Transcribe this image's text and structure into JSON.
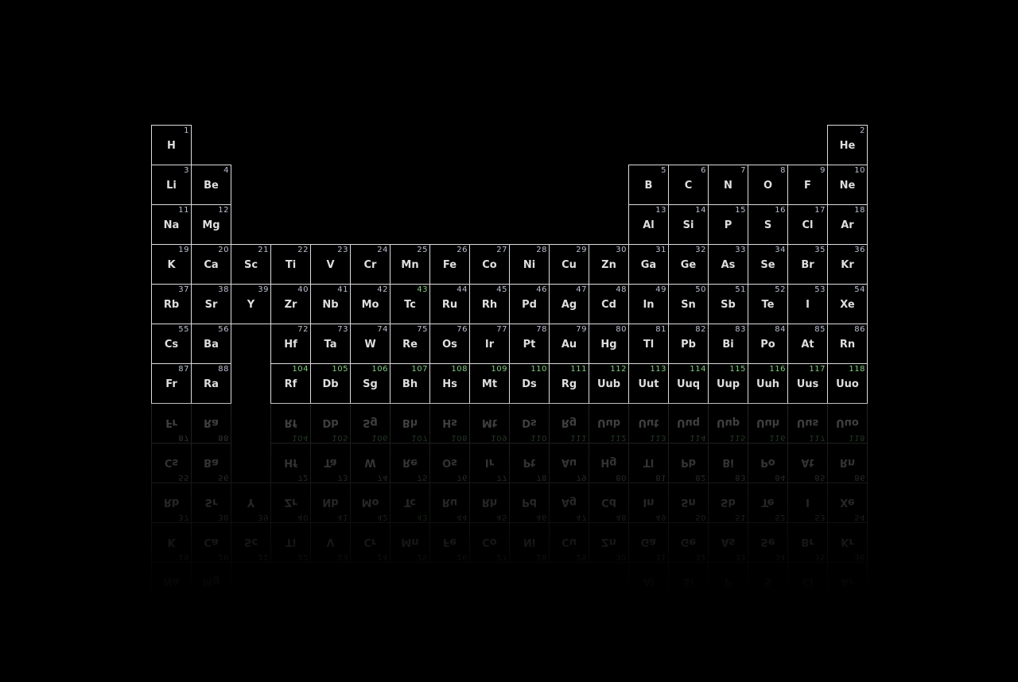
{
  "colors": {
    "background": "#000000",
    "border": "#dcdcdc",
    "symbol": "#dedede",
    "number": "#b8c0d0",
    "synthetic_number": "#7fcf7f"
  },
  "elements": [
    {
      "n": 1,
      "s": "H",
      "p": 1,
      "g": 1
    },
    {
      "n": 2,
      "s": "He",
      "p": 1,
      "g": 18
    },
    {
      "n": 3,
      "s": "Li",
      "p": 2,
      "g": 1
    },
    {
      "n": 4,
      "s": "Be",
      "p": 2,
      "g": 2
    },
    {
      "n": 5,
      "s": "B",
      "p": 2,
      "g": 13
    },
    {
      "n": 6,
      "s": "C",
      "p": 2,
      "g": 14
    },
    {
      "n": 7,
      "s": "N",
      "p": 2,
      "g": 15
    },
    {
      "n": 8,
      "s": "O",
      "p": 2,
      "g": 16
    },
    {
      "n": 9,
      "s": "F",
      "p": 2,
      "g": 17
    },
    {
      "n": 10,
      "s": "Ne",
      "p": 2,
      "g": 18
    },
    {
      "n": 11,
      "s": "Na",
      "p": 3,
      "g": 1
    },
    {
      "n": 12,
      "s": "Mg",
      "p": 3,
      "g": 2
    },
    {
      "n": 13,
      "s": "Al",
      "p": 3,
      "g": 13
    },
    {
      "n": 14,
      "s": "Si",
      "p": 3,
      "g": 14
    },
    {
      "n": 15,
      "s": "P",
      "p": 3,
      "g": 15
    },
    {
      "n": 16,
      "s": "S",
      "p": 3,
      "g": 16
    },
    {
      "n": 17,
      "s": "Cl",
      "p": 3,
      "g": 17
    },
    {
      "n": 18,
      "s": "Ar",
      "p": 3,
      "g": 18
    },
    {
      "n": 19,
      "s": "K",
      "p": 4,
      "g": 1
    },
    {
      "n": 20,
      "s": "Ca",
      "p": 4,
      "g": 2
    },
    {
      "n": 21,
      "s": "Sc",
      "p": 4,
      "g": 3
    },
    {
      "n": 22,
      "s": "Ti",
      "p": 4,
      "g": 4
    },
    {
      "n": 23,
      "s": "V",
      "p": 4,
      "g": 5
    },
    {
      "n": 24,
      "s": "Cr",
      "p": 4,
      "g": 6
    },
    {
      "n": 25,
      "s": "Mn",
      "p": 4,
      "g": 7
    },
    {
      "n": 26,
      "s": "Fe",
      "p": 4,
      "g": 8
    },
    {
      "n": 27,
      "s": "Co",
      "p": 4,
      "g": 9
    },
    {
      "n": 28,
      "s": "Ni",
      "p": 4,
      "g": 10
    },
    {
      "n": 29,
      "s": "Cu",
      "p": 4,
      "g": 11
    },
    {
      "n": 30,
      "s": "Zn",
      "p": 4,
      "g": 12
    },
    {
      "n": 31,
      "s": "Ga",
      "p": 4,
      "g": 13
    },
    {
      "n": 32,
      "s": "Ge",
      "p": 4,
      "g": 14
    },
    {
      "n": 33,
      "s": "As",
      "p": 4,
      "g": 15
    },
    {
      "n": 34,
      "s": "Se",
      "p": 4,
      "g": 16
    },
    {
      "n": 35,
      "s": "Br",
      "p": 4,
      "g": 17
    },
    {
      "n": 36,
      "s": "Kr",
      "p": 4,
      "g": 18
    },
    {
      "n": 37,
      "s": "Rb",
      "p": 5,
      "g": 1
    },
    {
      "n": 38,
      "s": "Sr",
      "p": 5,
      "g": 2
    },
    {
      "n": 39,
      "s": "Y",
      "p": 5,
      "g": 3
    },
    {
      "n": 40,
      "s": "Zr",
      "p": 5,
      "g": 4
    },
    {
      "n": 41,
      "s": "Nb",
      "p": 5,
      "g": 5
    },
    {
      "n": 42,
      "s": "Mo",
      "p": 5,
      "g": 6
    },
    {
      "n": 43,
      "s": "Tc",
      "p": 5,
      "g": 7,
      "synthetic": true
    },
    {
      "n": 44,
      "s": "Ru",
      "p": 5,
      "g": 8
    },
    {
      "n": 45,
      "s": "Rh",
      "p": 5,
      "g": 9
    },
    {
      "n": 46,
      "s": "Pd",
      "p": 5,
      "g": 10
    },
    {
      "n": 47,
      "s": "Ag",
      "p": 5,
      "g": 11
    },
    {
      "n": 48,
      "s": "Cd",
      "p": 5,
      "g": 12
    },
    {
      "n": 49,
      "s": "In",
      "p": 5,
      "g": 13
    },
    {
      "n": 50,
      "s": "Sn",
      "p": 5,
      "g": 14
    },
    {
      "n": 51,
      "s": "Sb",
      "p": 5,
      "g": 15
    },
    {
      "n": 52,
      "s": "Te",
      "p": 5,
      "g": 16
    },
    {
      "n": 53,
      "s": "I",
      "p": 5,
      "g": 17
    },
    {
      "n": 54,
      "s": "Xe",
      "p": 5,
      "g": 18
    },
    {
      "n": 55,
      "s": "Cs",
      "p": 6,
      "g": 1
    },
    {
      "n": 56,
      "s": "Ba",
      "p": 6,
      "g": 2
    },
    {
      "n": 72,
      "s": "Hf",
      "p": 6,
      "g": 4
    },
    {
      "n": 73,
      "s": "Ta",
      "p": 6,
      "g": 5
    },
    {
      "n": 74,
      "s": "W",
      "p": 6,
      "g": 6
    },
    {
      "n": 75,
      "s": "Re",
      "p": 6,
      "g": 7
    },
    {
      "n": 76,
      "s": "Os",
      "p": 6,
      "g": 8
    },
    {
      "n": 77,
      "s": "Ir",
      "p": 6,
      "g": 9
    },
    {
      "n": 78,
      "s": "Pt",
      "p": 6,
      "g": 10
    },
    {
      "n": 79,
      "s": "Au",
      "p": 6,
      "g": 11
    },
    {
      "n": 80,
      "s": "Hg",
      "p": 6,
      "g": 12
    },
    {
      "n": 81,
      "s": "Tl",
      "p": 6,
      "g": 13
    },
    {
      "n": 82,
      "s": "Pb",
      "p": 6,
      "g": 14
    },
    {
      "n": 83,
      "s": "Bi",
      "p": 6,
      "g": 15
    },
    {
      "n": 84,
      "s": "Po",
      "p": 6,
      "g": 16
    },
    {
      "n": 85,
      "s": "At",
      "p": 6,
      "g": 17
    },
    {
      "n": 86,
      "s": "Rn",
      "p": 6,
      "g": 18
    },
    {
      "n": 87,
      "s": "Fr",
      "p": 7,
      "g": 1
    },
    {
      "n": 88,
      "s": "Ra",
      "p": 7,
      "g": 2
    },
    {
      "n": 104,
      "s": "Rf",
      "p": 7,
      "g": 4,
      "synthetic": true
    },
    {
      "n": 105,
      "s": "Db",
      "p": 7,
      "g": 5,
      "synthetic": true
    },
    {
      "n": 106,
      "s": "Sg",
      "p": 7,
      "g": 6,
      "synthetic": true
    },
    {
      "n": 107,
      "s": "Bh",
      "p": 7,
      "g": 7,
      "synthetic": true
    },
    {
      "n": 108,
      "s": "Hs",
      "p": 7,
      "g": 8,
      "synthetic": true
    },
    {
      "n": 109,
      "s": "Mt",
      "p": 7,
      "g": 9,
      "synthetic": true
    },
    {
      "n": 110,
      "s": "Ds",
      "p": 7,
      "g": 10,
      "synthetic": true
    },
    {
      "n": 111,
      "s": "Rg",
      "p": 7,
      "g": 11,
      "synthetic": true
    },
    {
      "n": 112,
      "s": "Uub",
      "p": 7,
      "g": 12,
      "synthetic": true
    },
    {
      "n": 113,
      "s": "Uut",
      "p": 7,
      "g": 13,
      "synthetic": true
    },
    {
      "n": 114,
      "s": "Uuq",
      "p": 7,
      "g": 14,
      "synthetic": true
    },
    {
      "n": 115,
      "s": "Uup",
      "p": 7,
      "g": 15,
      "synthetic": true
    },
    {
      "n": 116,
      "s": "Uuh",
      "p": 7,
      "g": 16,
      "synthetic": true
    },
    {
      "n": 117,
      "s": "Uus",
      "p": 7,
      "g": 17,
      "synthetic": true
    },
    {
      "n": 118,
      "s": "Uuo",
      "p": 7,
      "g": 18,
      "synthetic": true
    }
  ]
}
